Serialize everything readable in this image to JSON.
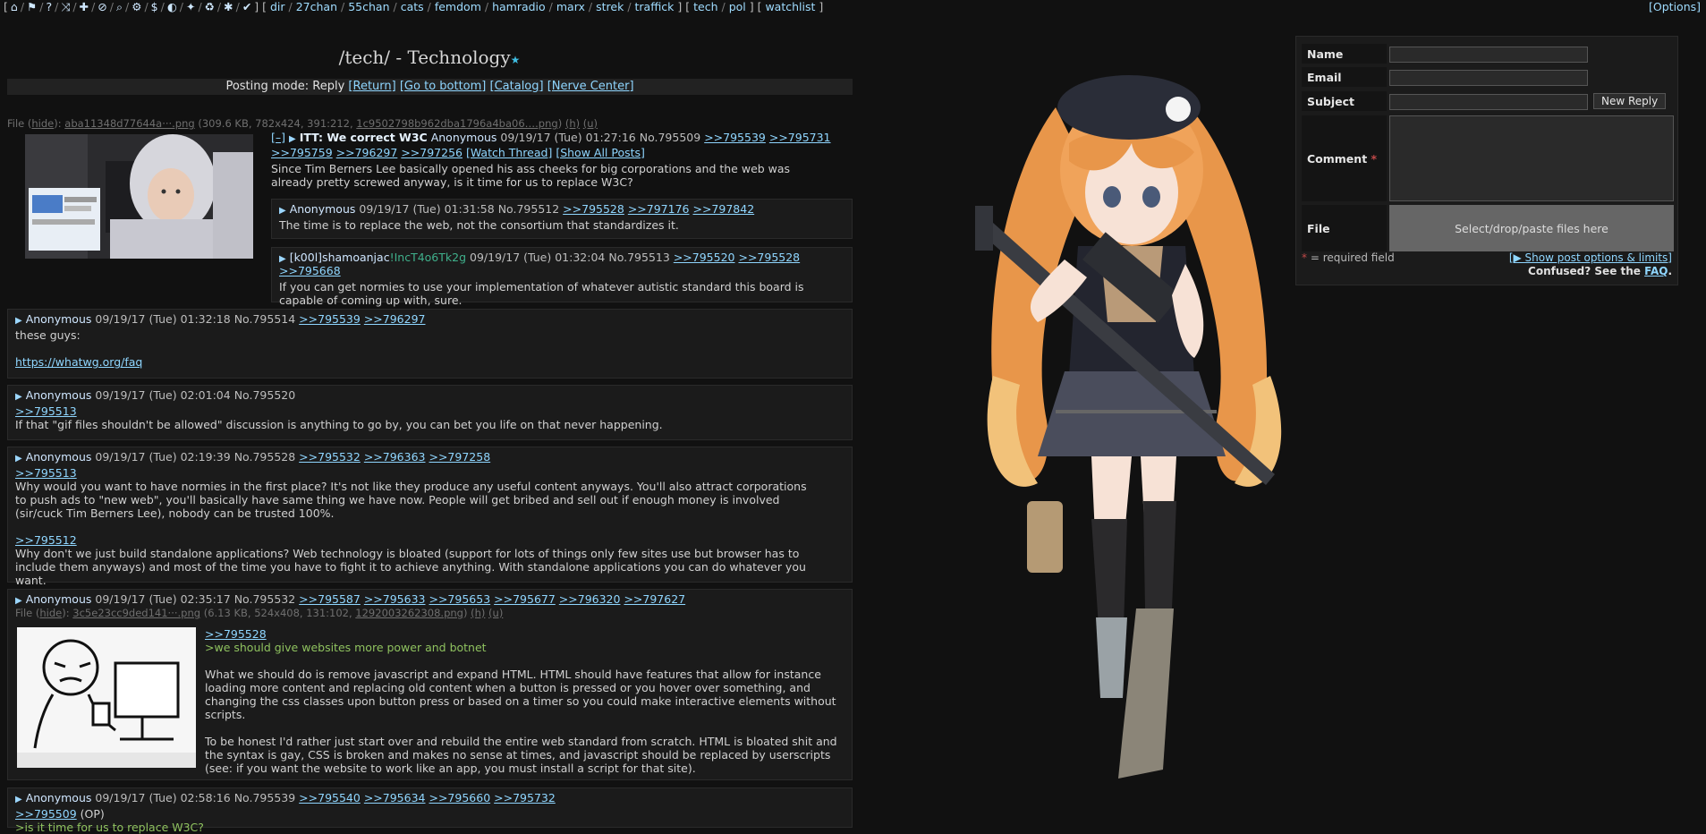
{
  "topbar": {
    "dirs": [
      "dir",
      "27chan",
      "55chan",
      "cats",
      "femdom",
      "hamradio",
      "marx",
      "strek",
      "traffick"
    ],
    "boards": [
      "tech",
      "pol"
    ],
    "watchlist": "watchlist",
    "options": "[Options]"
  },
  "board": {
    "title": "/tech/ - Technology"
  },
  "postmode": {
    "label": "Posting mode: Reply",
    "return": "[Return]",
    "bottom": "[Go to bottom]",
    "catalog": "[Catalog]",
    "nerve": "[Nerve Center]"
  },
  "op": {
    "fileinfo_prefix": "File (",
    "hide": "hide",
    "filename": "aba11348d77644a···.png",
    "filemeta": "(309.6 KB, 782x424, 391:212,",
    "origname": "1c9502798b962dba1796a4ba06….png",
    "h": "(h)",
    "u": "(u)",
    "toggle": "[–]",
    "subject": "ITT: We correct W3C",
    "name": "Anonymous",
    "date": "09/19/17 (Tue) 01:27:16",
    "no": "No.795509",
    "backlinks": [
      ">>795539",
      ">>795731",
      ">>795759",
      ">>796297",
      ">>797256"
    ],
    "watch": "[Watch Thread]",
    "showall": "[Show All Posts]",
    "body": "Since Tim Berners Lee basically opened his ass cheeks for big corporations and the web was already pretty screwed anyway, is it time for us to replace W3C?"
  },
  "replies": [
    {
      "name": "Anonymous",
      "date": "09/19/17 (Tue) 01:31:58",
      "no": "No.795512",
      "backlinks": [
        ">>795528",
        ">>797176",
        ">>797842"
      ],
      "body": "The time is to replace the web, not the consortium that standardizes it."
    },
    {
      "name": "[k00l]shamoanjac",
      "trip": "!IncT4o6Tk2g",
      "date": "09/19/17 (Tue) 01:32:04",
      "no": "No.795513",
      "backlinks": [
        ">>795520",
        ">>795528",
        ">>795668"
      ],
      "body": "If you can get normies to use your implementation of whatever autistic standard this board is capable of coming up with, sure."
    },
    {
      "name": "Anonymous",
      "date": "09/19/17 (Tue) 01:32:18",
      "no": "No.795514",
      "backlinks": [
        ">>795539",
        ">>796297"
      ],
      "line1": "these guys:",
      "link": "https://whatwg.org/faq"
    },
    {
      "name": "Anonymous",
      "date": "09/19/17 (Tue) 02:01:04",
      "no": "No.795520",
      "backlinks": [],
      "ref": ">>795513",
      "body": "If that \"gif files shouldn't be allowed\" discussion is anything to go by, you can bet you life on that never happening."
    },
    {
      "name": "Anonymous",
      "date": "09/19/17 (Tue) 02:19:39",
      "no": "No.795528",
      "backlinks": [
        ">>795532",
        ">>796363",
        ">>797258"
      ],
      "ref1": ">>795513",
      "body1": "Why would you want to have normies in the first place? It's not like they produce any useful content anyways. You'll also attract corporations to push ads to \"new web\", you'll basically have same thing we have now. People will get bribed and sell out if enough money is involved (sir/cuck Tim Berners Lee), nobody can be trusted 100%.",
      "ref2": ">>795512",
      "body2": "Why don't we just build standalone applications? Web technology is bloated (support for lots of things only few sites use but browser has to include them anyways) and most of the time you have to fight it to achieve anything. With standalone applications you can do whatever you want."
    },
    {
      "name": "Anonymous",
      "date": "09/19/17 (Tue) 02:35:17",
      "no": "No.795532",
      "backlinks": [
        ">>795587",
        ">>795633",
        ">>795653",
        ">>795677",
        ">>796320",
        ">>797627"
      ],
      "fileinfo_prefix": "File (",
      "hide": "hide",
      "filename": "3c5e23cc9ded141···.png",
      "filemeta": "(6.13 KB, 524x408, 131:102,",
      "origname": "1292003262308.png",
      "h": "(h)",
      "u": "(u)",
      "ref": ">>795528",
      "greentext": ">we should give websites more power and botnet",
      "body1": "What we should do is remove javascript and expand HTML. HTML should have features that allow for instance loading more content and replacing old content when a button is pressed or you hover over something, and changing the css classes upon button press or based on a timer so you could make interactive elements without scripts.",
      "body2": "To be honest I'd rather just start over and rebuild the entire web standard from scratch. HTML is bloated shit and the syntax is gay, CSS is broken and makes no sense at times, and javascript should be replaced by userscripts (see: if you want the website to work like an app, you must install a script for that site)."
    },
    {
      "name": "Anonymous",
      "date": "09/19/17 (Tue) 02:58:16",
      "no": "No.795539",
      "backlinks": [
        ">>795540",
        ">>795634",
        ">>795660",
        ">>795732"
      ],
      "ref": ">>795509",
      "op_tag": "(OP)",
      "greentext": ">is it time for us to replace W3C?"
    }
  ],
  "form": {
    "name_label": "Name",
    "email_label": "Email",
    "subject_label": "Subject",
    "comment_label": "Comment",
    "required_mark": "*",
    "file_label": "File",
    "new_reply": "New Reply",
    "dropzone": "Select/drop/paste files here",
    "required_note": "= required field",
    "show_options": "[▶ Show post options & limits]",
    "confused": "Confused? See the",
    "faq": "FAQ",
    "period": "."
  },
  "colors": {
    "bg": "#111111",
    "link": "#8fd6ff",
    "quote": "#8fc25f",
    "post_bg": "#1b1b1b"
  }
}
